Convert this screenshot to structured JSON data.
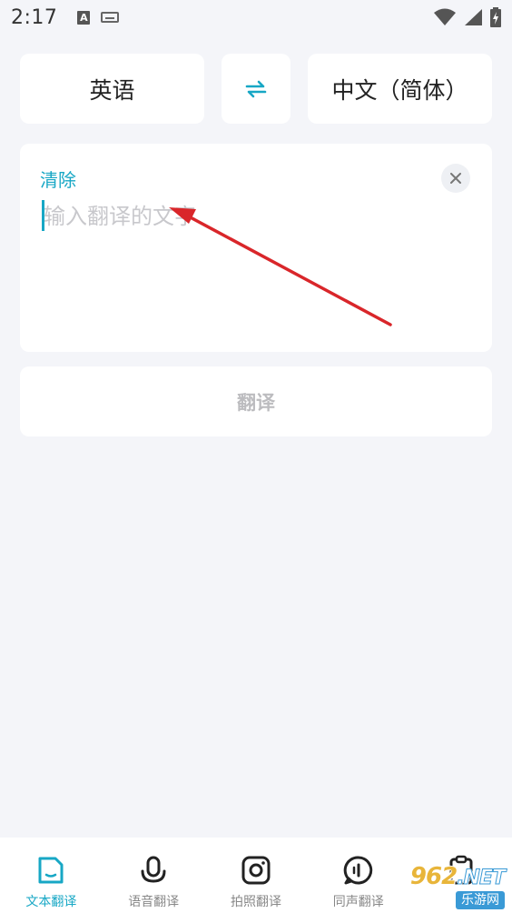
{
  "status_bar": {
    "time": "2:17",
    "notification_icons": [
      "a-badge-icon",
      "keyboard-icon"
    ],
    "system_icons": [
      "wifi-icon",
      "signal-icon",
      "battery-icon"
    ]
  },
  "language_selector": {
    "source": "英语",
    "swap_icon": "swap-arrows-icon",
    "target": "中文（简体）"
  },
  "input": {
    "clear_label": "清除",
    "placeholder": "输入翻译的文字",
    "value": "",
    "close_icon": "close-icon"
  },
  "translate_button": {
    "label": "翻译"
  },
  "bottom_nav": {
    "items": [
      {
        "label": "文本翻译",
        "icon": "document-icon",
        "active": true
      },
      {
        "label": "语音翻译",
        "icon": "microphone-icon",
        "active": false
      },
      {
        "label": "拍照翻译",
        "icon": "camera-icon",
        "active": false
      },
      {
        "label": "同声翻译",
        "icon": "simultaneous-icon",
        "active": false
      },
      {
        "label": "",
        "icon": "clipboard-icon",
        "active": false
      }
    ]
  },
  "watermark": {
    "brand": "962",
    "suffix": ".NET",
    "subtitle": "乐游网"
  },
  "colors": {
    "accent": "#17a7c5",
    "background": "#f4f5f9",
    "card": "#ffffff",
    "annotation": "#d9262a"
  }
}
